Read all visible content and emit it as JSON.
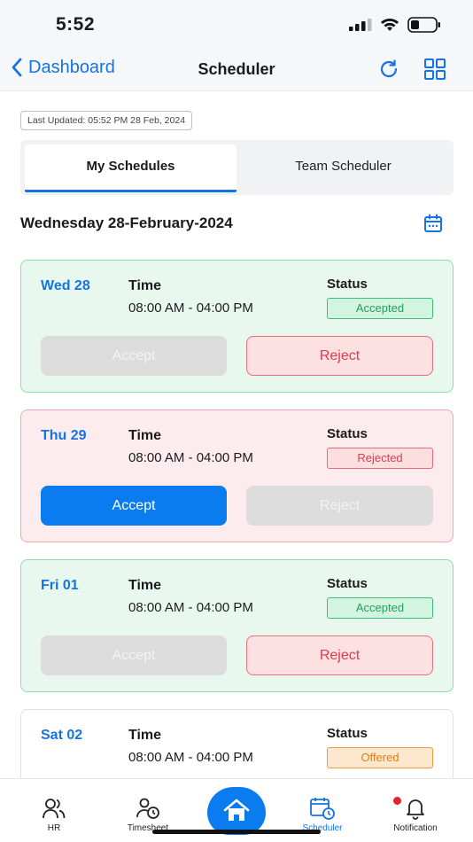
{
  "status_bar": {
    "time": "5:52"
  },
  "nav": {
    "back_label": "Dashboard",
    "title": "Scheduler"
  },
  "last_updated": "Last Updated: 05:52 PM 28 Feb, 2024",
  "tabs": [
    {
      "label": "My Schedules",
      "active": true
    },
    {
      "label": "Team Scheduler",
      "active": false
    }
  ],
  "date_heading": "Wednesday 28-February-2024",
  "time_label": "Time",
  "status_label": "Status",
  "schedules": [
    {
      "day": "Wed 28",
      "time": "08:00 AM - 04:00 PM",
      "status": "Accepted",
      "accept_label": "Accept",
      "reject_label": "Reject"
    },
    {
      "day": "Thu 29",
      "time": "08:00 AM - 04:00 PM",
      "status": "Rejected",
      "accept_label": "Accept",
      "reject_label": "Reject"
    },
    {
      "day": "Fri 01",
      "time": "08:00 AM - 04:00 PM",
      "status": "Accepted",
      "accept_label": "Accept",
      "reject_label": "Reject"
    },
    {
      "day": "Sat 02",
      "time": "08:00 AM - 04:00 PM",
      "status": "Offered"
    }
  ],
  "bottom_tabs": [
    {
      "label": "HR",
      "icon": "users-icon"
    },
    {
      "label": "Timesheet",
      "icon": "user-clock-icon"
    },
    {
      "label": "",
      "icon": "home-icon"
    },
    {
      "label": "Scheduler",
      "icon": "calendar-clock-icon",
      "active": true
    },
    {
      "label": "Notification",
      "icon": "bell-icon"
    }
  ],
  "colors": {
    "accent": "#1473e6",
    "accepted": "#22a05a",
    "rejected": "#d8404e",
    "offered": "#e27d13"
  }
}
